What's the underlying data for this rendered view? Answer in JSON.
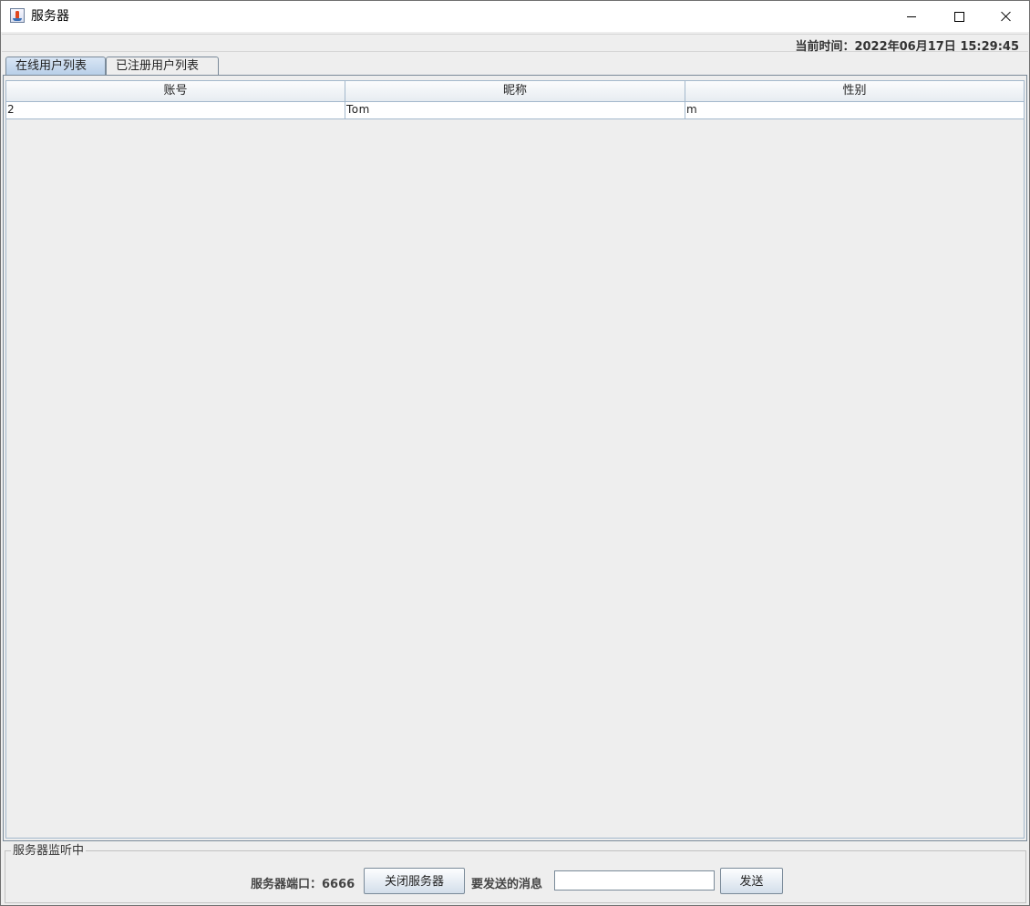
{
  "window": {
    "title": "服务器"
  },
  "status": {
    "current_time": "当前时间：2022年06月17日 15:29:45"
  },
  "tabs": [
    {
      "label": "在线用户列表",
      "selected": true
    },
    {
      "label": "已注册用户列表",
      "selected": false
    }
  ],
  "table": {
    "headers": [
      "账号",
      "昵称",
      "性别"
    ],
    "rows": [
      [
        "2",
        "Tom",
        "m"
      ]
    ]
  },
  "control_panel": {
    "group_title": "服务器监听中",
    "port_label": "服务器端口：6666",
    "close_server_label": "关闭服务器",
    "message_label": "要发送的消息",
    "message_value": "",
    "send_label": "发送"
  },
  "icons": {
    "app": "java-cup-icon",
    "minimize": "minimize-icon",
    "maximize": "maximize-icon",
    "close": "close-icon"
  }
}
